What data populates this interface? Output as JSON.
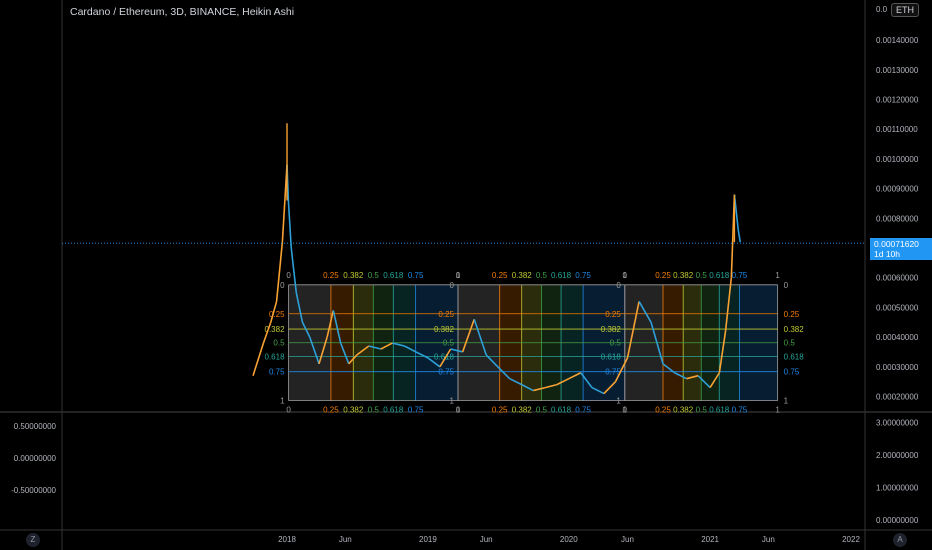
{
  "header": {
    "title": "Cardano / Ethereum, 3D, BINANCE, Heikin Ashi",
    "currency": "ETH"
  },
  "price_tag": {
    "price": "0.00071620",
    "countdown": "1d 10h"
  },
  "corner_buttons": {
    "left": "Z",
    "right": "A"
  },
  "colors": {
    "background": "#000000",
    "candle_up": "#f7a233",
    "candle_down": "#2da0d8",
    "fib_0": "#9e9e9e",
    "fib_025": "#f57c00",
    "fib_0382": "#c0ca33",
    "fib_05": "#43a047",
    "fib_0618": "#26a69a",
    "fib_075": "#1e88e5",
    "fib_1": "#9e9e9e"
  },
  "chart_data": [
    {
      "type": "line",
      "chart_style": "heikin-ashi candles",
      "title": "Cardano / Ethereum, 3D, BINANCE, Heikin Ashi",
      "y_axis_side": "right",
      "y_ticks": [
        "0.00140000",
        "0.00130000",
        "0.00120000",
        "0.00110000",
        "0.00100000",
        "0.00090000",
        "0.00080000",
        "0.00070000",
        "0.00060000",
        "0.00050000",
        "0.00040000",
        "0.00030000",
        "0.00020000"
      ],
      "ylim": [
        0.00016,
        0.00152
      ],
      "x_ticks": [
        "2018",
        "Jun",
        "2019",
        "Jun",
        "2020",
        "Jun",
        "2021",
        "Jun",
        "2022"
      ],
      "x_tick_dates": [
        "2018-01-01",
        "2018-06-01",
        "2019-01-01",
        "2019-06-01",
        "2020-01-01",
        "2020-06-01",
        "2021-01-01",
        "2021-06-01",
        "2022-01-01"
      ],
      "last_price": 0.0007162,
      "series": [
        {
          "x": [
            "2017-10-05",
            "2017-11-01",
            "2017-11-20",
            "2017-12-05",
            "2017-12-20",
            "2018-01-01",
            "2018-01-05",
            "2018-01-12",
            "2018-01-25",
            "2018-02-10",
            "2018-03-01",
            "2018-03-25",
            "2018-04-15",
            "2018-05-01",
            "2018-05-20",
            "2018-06-10",
            "2018-07-01",
            "2018-08-01",
            "2018-09-01",
            "2018-10-01",
            "2018-11-01",
            "2018-12-01",
            "2019-01-01",
            "2019-02-01",
            "2019-03-01",
            "2019-04-01",
            "2019-05-01",
            "2019-06-01",
            "2019-07-01",
            "2019-08-01",
            "2019-09-01",
            "2019-10-01",
            "2019-11-01",
            "2019-12-01",
            "2020-01-01",
            "2020-02-01",
            "2020-03-01",
            "2020-04-01",
            "2020-05-01",
            "2020-06-01",
            "2020-07-01",
            "2020-08-01",
            "2020-09-01",
            "2020-10-01",
            "2020-11-01",
            "2020-12-01",
            "2021-01-01",
            "2021-01-25",
            "2021-02-10",
            "2021-02-25",
            "2021-03-05",
            "2021-03-15",
            "2021-03-20"
          ],
          "values": [
            0.00027,
            0.00038,
            0.00045,
            0.00052,
            0.00072,
            0.00098,
            0.00085,
            0.0007,
            0.00055,
            0.00045,
            0.0004,
            0.00031,
            0.0004,
            0.00049,
            0.00038,
            0.00031,
            0.00034,
            0.00037,
            0.00036,
            0.00038,
            0.00037,
            0.00035,
            0.00033,
            0.0003,
            0.00036,
            0.00035,
            0.00046,
            0.00034,
            0.0003,
            0.00026,
            0.00024,
            0.00022,
            0.00023,
            0.00024,
            0.00026,
            0.00028,
            0.00023,
            0.00021,
            0.00025,
            0.00033,
            0.00052,
            0.00045,
            0.00031,
            0.00028,
            0.00026,
            0.00027,
            0.00023,
            0.00028,
            0.00042,
            0.0006,
            0.00088,
            0.00076,
            0.00072
          ]
        }
      ],
      "fib_levels": [
        "0",
        "0.25",
        "0.382",
        "0.5",
        "0.618",
        "0.75",
        "1"
      ],
      "fib_zones": [
        {
          "start": "2018-01-05",
          "end": "2019-03-20",
          "top": 0.000576,
          "bottom": 0.000186
        },
        {
          "start": "2019-03-20",
          "end": "2020-05-25",
          "top": 0.000576,
          "bottom": 0.000186
        },
        {
          "start": "2020-05-25",
          "end": "2021-06-25",
          "top": 0.000576,
          "bottom": 0.000186
        }
      ]
    },
    {
      "type": "line",
      "title": "",
      "y_axis_side": "left",
      "y_ticks": [
        "0.50000000",
        "0.00000000",
        "-0.50000000"
      ],
      "ylim": [
        -0.65,
        0.65
      ]
    },
    {
      "type": "line",
      "title": "",
      "y_axis_side": "right",
      "y_ticks": [
        "3.00000000",
        "2.00000000",
        "1.00000000",
        "0.00000000"
      ],
      "ylim": [
        -0.2,
        3.5
      ]
    }
  ]
}
